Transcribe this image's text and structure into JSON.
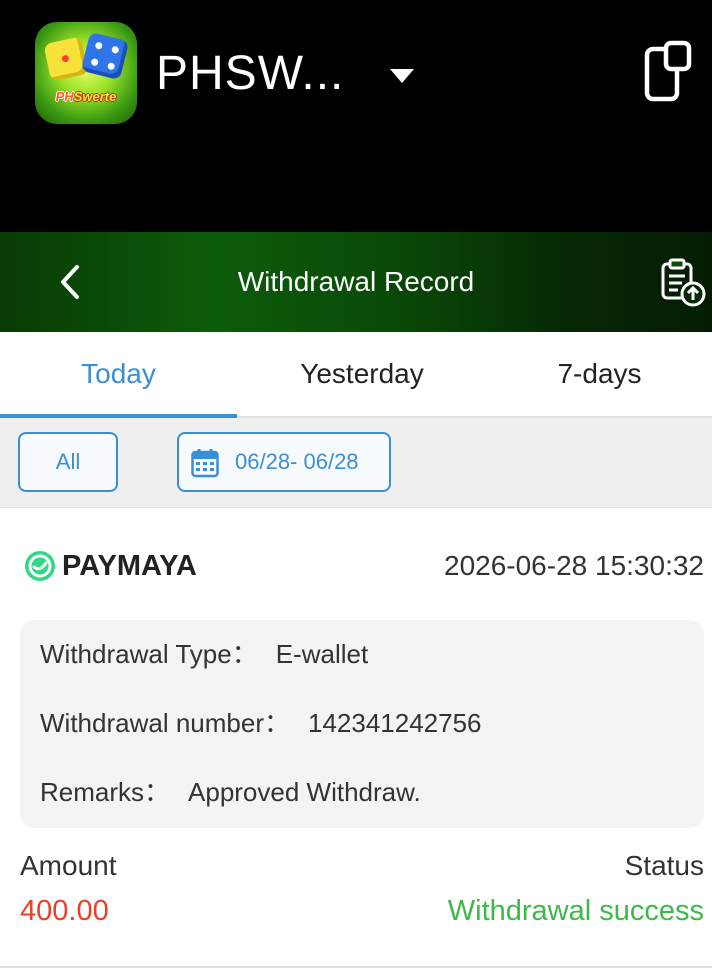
{
  "app": {
    "title": "PHSW...",
    "logo_text_prefix": "PH",
    "logo_text_suffix": "Swerte",
    "icons": {
      "dropdown": "caret-down-icon",
      "window": "window-switch-icon"
    }
  },
  "header": {
    "title": "Withdrawal Record",
    "icons": {
      "back": "chevron-left-icon",
      "export": "clipboard-upload-icon"
    }
  },
  "tabs": [
    {
      "label": "Today",
      "active": true
    },
    {
      "label": "Yesterday",
      "active": false
    },
    {
      "label": "7-days",
      "active": false
    }
  ],
  "filters": {
    "all_label": "All",
    "date_range": "06/28- 06/28",
    "date_icon": "calendar-icon"
  },
  "record": {
    "method": "PAYMAYA",
    "method_icon": "paymaya-icon",
    "time": "2026-06-28 15:30:32",
    "type_label": "Withdrawal Type：",
    "type_value": "E-wallet",
    "number_label": "Withdrawal number：",
    "number_value": "142341242756",
    "remarks_label": "Remarks：",
    "remarks_value": "Approved Withdraw.",
    "amount_label": "Amount",
    "amount_value": "400.00",
    "status_label": "Status",
    "status_value": "Withdrawal success"
  },
  "colors": {
    "accent": "#3b8fd6",
    "amount": "#e8402a",
    "success": "#3fb84a",
    "header_green": "#0c5b0a"
  }
}
